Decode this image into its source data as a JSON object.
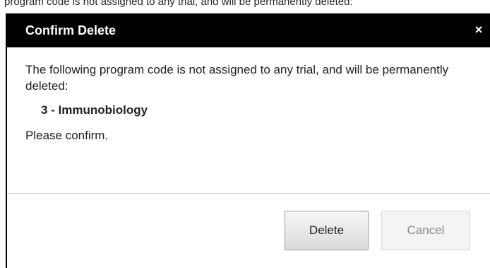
{
  "background": {
    "partial_text": "program code is not assigned to any trial, and will be permanently deleted:"
  },
  "dialog": {
    "title": "Confirm Delete",
    "close_glyph": "×",
    "message": "The following program code is not assigned to any trial, and will be permanently deleted:",
    "item": "3 - Immunobiology",
    "confirm_prompt": "Please confirm.",
    "buttons": {
      "delete": "Delete",
      "cancel": "Cancel"
    }
  },
  "colors": {
    "titlebar_bg": "#000000",
    "title_text": "#ffffff",
    "cancel_text": "#8a8a8a"
  },
  "icons": {
    "close": "close-icon"
  }
}
